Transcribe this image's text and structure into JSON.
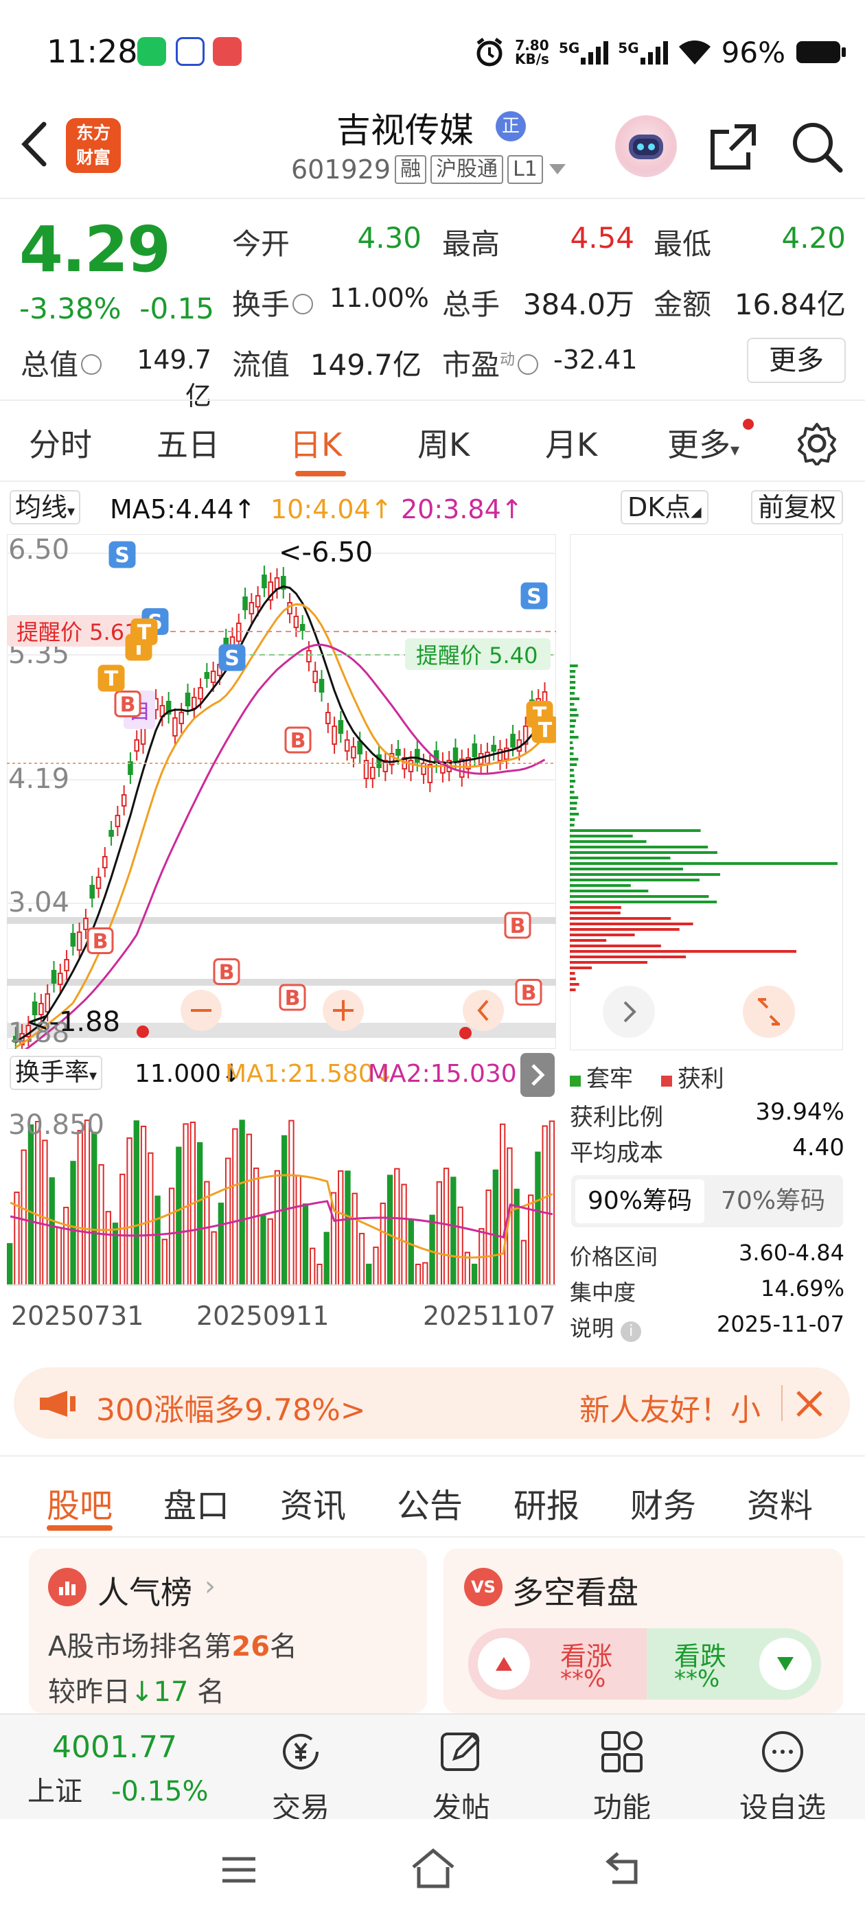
{
  "status_bar": {
    "time": "11:28",
    "net_speed_value": "7.80",
    "net_speed_unit": "KB/s",
    "net1": "5G",
    "net2": "5G",
    "battery": "96%"
  },
  "header": {
    "logo_line1": "东方",
    "logo_line2": "财富",
    "stock_name": "吉视传媒",
    "badge": "正",
    "stock_code": "601929",
    "tags": [
      "融",
      "沪股通",
      "L1"
    ]
  },
  "quote": {
    "price": "4.29",
    "change_pct": "-3.38%",
    "change": "-0.15",
    "row1": [
      {
        "label": "今开",
        "value": "4.30"
      },
      {
        "label": "最高",
        "value": "4.54"
      },
      {
        "label": "最低",
        "value": "4.20"
      }
    ],
    "row2": [
      {
        "label": "换手",
        "value": "11.00%"
      },
      {
        "label": "总手",
        "value": "384.0万"
      },
      {
        "label": "金额",
        "value": "16.84亿"
      }
    ],
    "row3": [
      {
        "label": "总值",
        "value": "149.7亿"
      },
      {
        "label": "流值",
        "value": "149.7亿"
      },
      {
        "label": "市盈",
        "sup": "动",
        "value": "-32.41"
      }
    ],
    "more": "更多"
  },
  "tabs": [
    "分时",
    "五日",
    "日K",
    "周K",
    "月K",
    "更多"
  ],
  "indicator": {
    "type": "均线",
    "ma5": "MA5:4.44",
    "ma10": "10:4.04",
    "ma20": "20:3.84",
    "dk": "DK点",
    "fq": "前复权"
  },
  "kline": {
    "y_labels": [
      "6.50",
      "5.35",
      "4.19",
      "3.04",
      "1.88"
    ],
    "high_mark": "<-6.50",
    "low_mark": "<-1.88",
    "alert_left": "提醒价 5.61",
    "alert_right": "提醒价 5.40",
    "self_mark": "自",
    "buy_mark": "B",
    "sell_mark": "S",
    "target_mark": "T"
  },
  "turnover": {
    "type": "换手率",
    "val": "11.000",
    "ma1": "MA1:21.580",
    "ma2": "MA2:15.030",
    "top_label": "30.850",
    "dates": [
      "20250731",
      "20250911",
      "20251107"
    ]
  },
  "chips": {
    "legend_locked": "套牢",
    "legend_profit": "获利",
    "stats": [
      {
        "label": "获利比例",
        "value": "39.94%"
      },
      {
        "label": "平均成本",
        "value": "4.40"
      }
    ],
    "tab_a": "90%筹码",
    "tab_b": "70%筹码",
    "stats2": [
      {
        "label": "价格区间",
        "value": "3.60-4.84"
      },
      {
        "label": "集中度",
        "value": "14.69%"
      },
      {
        "label": "说明",
        "value": "2025-11-07"
      }
    ]
  },
  "banner": {
    "left": "300涨幅多9.78%>",
    "right": "新人友好！小"
  },
  "subtabs": [
    "股吧",
    "盘口",
    "资讯",
    "公告",
    "研报",
    "财务",
    "资料"
  ],
  "card1": {
    "title": "人气榜",
    "line1_prefix": "A股市场排名第",
    "rank": "26",
    "line1_suffix": "名",
    "line2_prefix": "较昨日",
    "change": "17",
    "line2_suffix": "名"
  },
  "card2": {
    "title": "多空看盘",
    "up": "看涨",
    "up_val": "**%",
    "down": "看跌",
    "down_val": "**%"
  },
  "bottom_bar": {
    "index_value": "4001.77",
    "index_name": "上证",
    "index_change": "-0.15%",
    "items": [
      "交易",
      "发帖",
      "功能",
      "设自选"
    ]
  },
  "colors": {
    "up": "#e02929",
    "down": "#1b9b2e",
    "accent": "#e8632a",
    "ma5": "#111111",
    "ma10": "#f0a020",
    "ma20": "#cc2a9a"
  }
}
